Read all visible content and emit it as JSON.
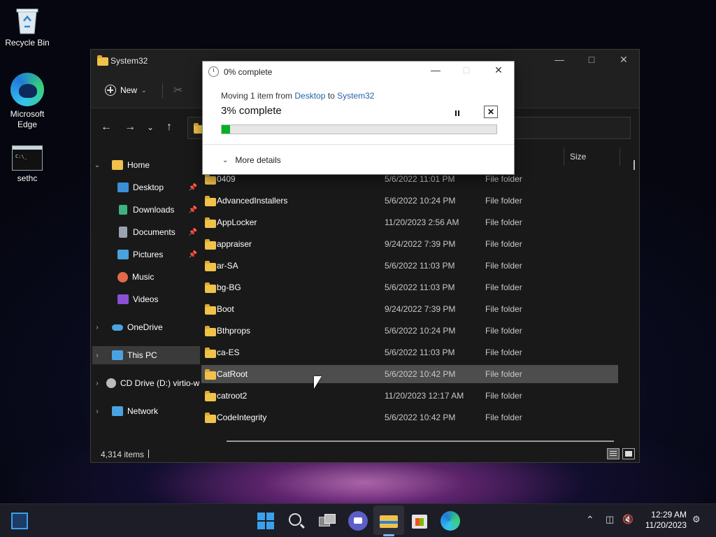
{
  "desktop": {
    "icons": [
      {
        "label": "Recycle Bin",
        "icon": "recycle-bin-icon"
      },
      {
        "label": "Microsoft Edge",
        "icon": "edge-icon"
      },
      {
        "label": "sethc",
        "icon": "cmd-icon"
      }
    ],
    "cmd_prompt_text": "C:\\_"
  },
  "explorer": {
    "title": "System32",
    "toolbar": {
      "new_label": "New"
    },
    "columns": {
      "size_label": "Size"
    },
    "sidebar": [
      {
        "label": "Home",
        "icon": "home-icon",
        "color": "#f0c14b"
      },
      {
        "label": "Desktop",
        "icon": "desktop-icon",
        "color": "#3b8fd6",
        "pinned": true
      },
      {
        "label": "Downloads",
        "icon": "download-icon",
        "color": "#3fb37f",
        "pinned": true
      },
      {
        "label": "Documents",
        "icon": "documents-icon",
        "color": "#9aa4b0",
        "pinned": true
      },
      {
        "label": "Pictures",
        "icon": "pictures-icon",
        "color": "#4aa3e0",
        "pinned": true
      },
      {
        "label": "Music",
        "icon": "music-icon",
        "color": "#e06a4a"
      },
      {
        "label": "Videos",
        "icon": "videos-icon",
        "color": "#8a4fd6"
      },
      {
        "label": "OneDrive",
        "icon": "onedrive-icon",
        "color": "#4aa3e0"
      },
      {
        "label": "This PC",
        "icon": "this-pc-icon",
        "color": "#4aa3e0"
      },
      {
        "label": "CD Drive (D:) virtio-w",
        "icon": "cd-drive-icon",
        "color": "#bbbbbb"
      },
      {
        "label": "Network",
        "icon": "network-icon",
        "color": "#4aa3e0"
      }
    ],
    "files": [
      {
        "name": "0409",
        "date": "5/6/2022 11:01 PM",
        "type": "File folder"
      },
      {
        "name": "AdvancedInstallers",
        "date": "5/6/2022 10:24 PM",
        "type": "File folder"
      },
      {
        "name": "AppLocker",
        "date": "11/20/2023 2:56 AM",
        "type": "File folder"
      },
      {
        "name": "appraiser",
        "date": "9/24/2022 7:39 PM",
        "type": "File folder"
      },
      {
        "name": "ar-SA",
        "date": "5/6/2022 11:03 PM",
        "type": "File folder"
      },
      {
        "name": "bg-BG",
        "date": "5/6/2022 11:03 PM",
        "type": "File folder"
      },
      {
        "name": "Boot",
        "date": "9/24/2022 7:39 PM",
        "type": "File folder"
      },
      {
        "name": "Bthprops",
        "date": "5/6/2022 10:24 PM",
        "type": "File folder"
      },
      {
        "name": "ca-ES",
        "date": "5/6/2022 11:03 PM",
        "type": "File folder"
      },
      {
        "name": "CatRoot",
        "date": "5/6/2022 10:42 PM",
        "type": "File folder"
      },
      {
        "name": "catroot2",
        "date": "11/20/2023 12:17 AM",
        "type": "File folder"
      },
      {
        "name": "CodeIntegrity",
        "date": "5/6/2022 10:42 PM",
        "type": "File folder"
      }
    ],
    "status": {
      "item_count": "4,314 items"
    }
  },
  "dialog": {
    "title": "0% complete",
    "moving_prefix": "Moving 1 item from ",
    "source": "Desktop",
    "moving_mid": " to ",
    "destination": "System32",
    "percent_text": "3% complete",
    "progress": 0.03,
    "more_details_label": "More details",
    "progress_color": "#06b025"
  },
  "taskbar": {
    "time": "12:29 AM",
    "date": "11/20/2023",
    "pinned": [
      "start-icon",
      "search-icon",
      "task-view-icon",
      "chat-icon",
      "file-explorer-icon",
      "store-icon",
      "edge-icon"
    ]
  }
}
